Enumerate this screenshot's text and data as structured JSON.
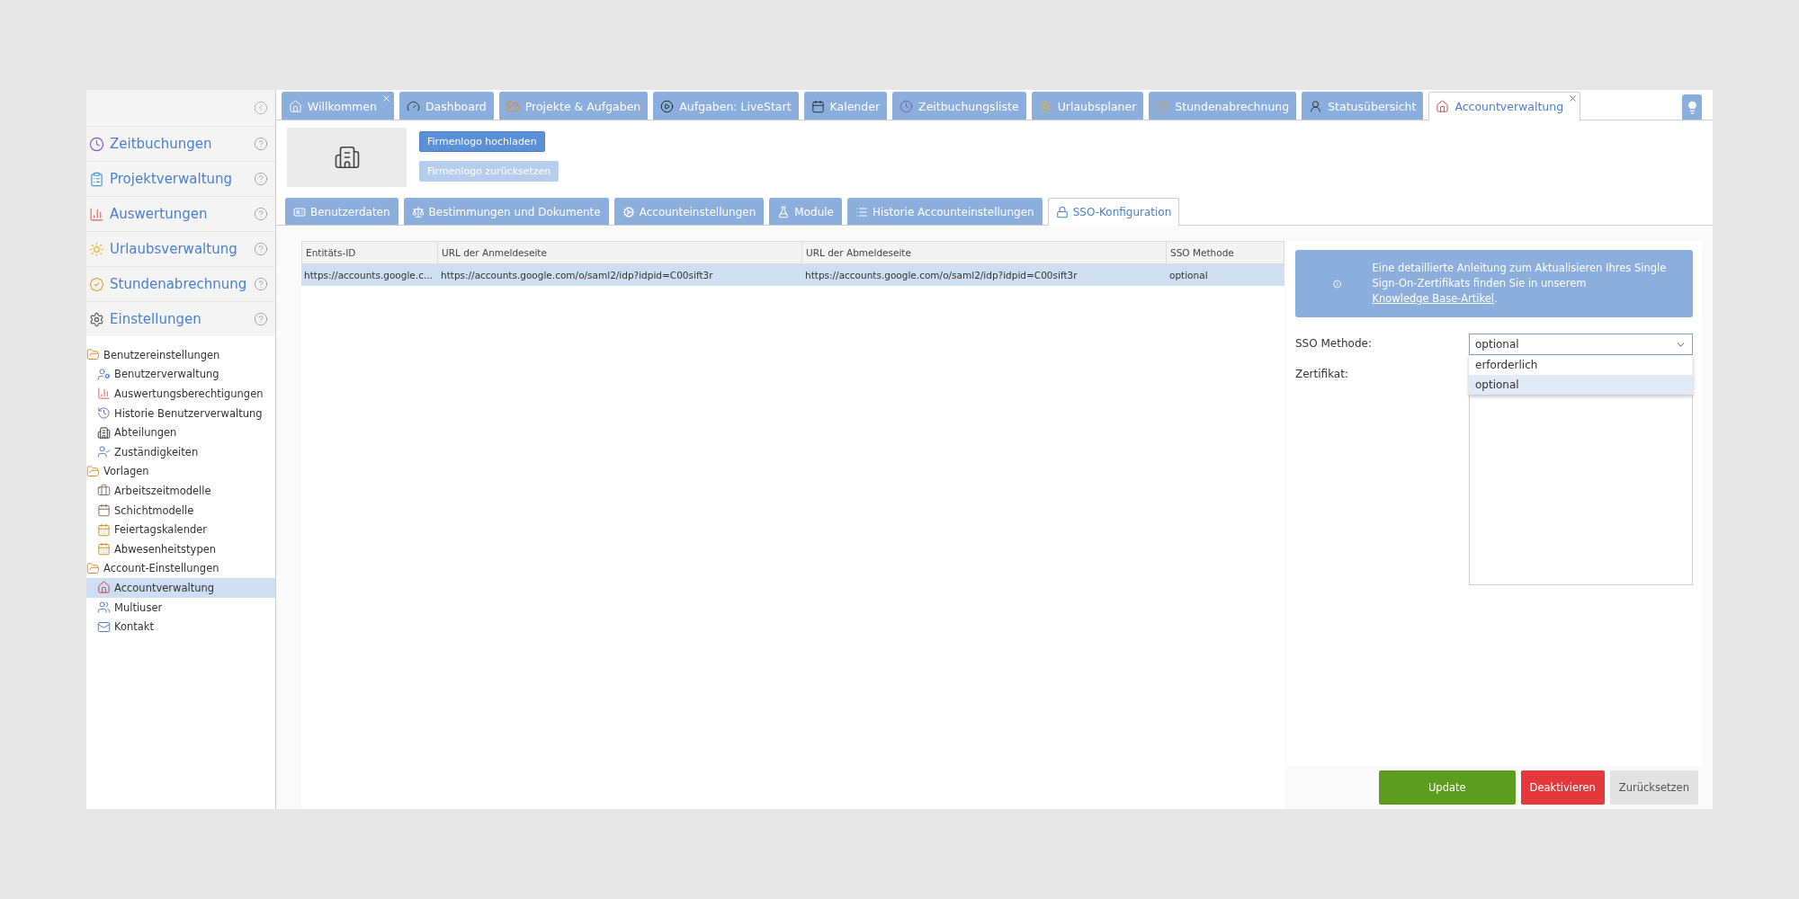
{
  "sidebar": {
    "sections": [
      {
        "label": "Zeitbuchungen"
      },
      {
        "label": "Projektverwaltung"
      },
      {
        "label": "Auswertungen"
      },
      {
        "label": "Urlaubsverwaltung"
      },
      {
        "label": "Stundenabrechnung"
      },
      {
        "label": "Einstellungen"
      }
    ],
    "tree": [
      {
        "label": "Benutzereinstellungen",
        "selected": false,
        "children": [
          {
            "label": "Benutzerverwaltung",
            "selected": false
          },
          {
            "label": "Auswertungsberechtigungen",
            "selected": false
          },
          {
            "label": "Historie Benutzerverwaltung",
            "selected": false
          },
          {
            "label": "Abteilungen",
            "selected": false
          },
          {
            "label": "Zuständigkeiten",
            "selected": false
          }
        ]
      },
      {
        "label": "Vorlagen",
        "selected": false,
        "children": [
          {
            "label": "Arbeitszeitmodelle",
            "selected": false
          },
          {
            "label": "Schichtmodelle",
            "selected": false
          },
          {
            "label": "Feiertagskalender",
            "selected": false
          },
          {
            "label": "Abwesenheitstypen",
            "selected": false
          }
        ]
      },
      {
        "label": "Account-Einstellungen",
        "selected": false,
        "children": [
          {
            "label": "Accountverwaltung",
            "selected": true
          },
          {
            "label": "Multiuser",
            "selected": false
          },
          {
            "label": "Kontakt",
            "selected": false
          }
        ]
      }
    ]
  },
  "tabs": [
    {
      "label": "Willkommen",
      "selected": false,
      "closable": true
    },
    {
      "label": "Dashboard",
      "selected": false,
      "closable": false
    },
    {
      "label": "Projekte & Aufgaben",
      "selected": false,
      "closable": false
    },
    {
      "label": "Aufgaben: LiveStart",
      "selected": false,
      "closable": false
    },
    {
      "label": "Kalender",
      "selected": false,
      "closable": false
    },
    {
      "label": "Zeitbuchungsliste",
      "selected": false,
      "closable": false
    },
    {
      "label": "Urlaubsplaner",
      "selected": false,
      "closable": false
    },
    {
      "label": "Stundenabrechnung",
      "selected": false,
      "closable": false
    },
    {
      "label": "Statusübersicht",
      "selected": false,
      "closable": false
    },
    {
      "label": "Accountverwaltung",
      "selected": true,
      "closable": true
    }
  ],
  "logo": {
    "buttons": [
      {
        "label": "Firmenlogo hochladen",
        "disabled": false
      },
      {
        "label": "Firmenlogo zurücksetzen",
        "disabled": true
      }
    ]
  },
  "subtabs": [
    {
      "label": "Benutzerdaten",
      "selected": false
    },
    {
      "label": "Bestimmungen und Dokumente",
      "selected": false
    },
    {
      "label": "Accounteinstellungen",
      "selected": false
    },
    {
      "label": "Module",
      "selected": false
    },
    {
      "label": "Historie Accounteinstellungen",
      "selected": false
    },
    {
      "label": "SSO-Konfiguration",
      "selected": true
    }
  ],
  "table": {
    "columns": [
      "Entitäts-ID",
      "URL der Anmeldeseite",
      "URL der Abmeldeseite",
      "SSO Methode"
    ],
    "rows": [
      {
        "selected": true,
        "cells": [
          "https://accounts.google.c...",
          "https://accounts.google.com/o/saml2/idp?idpid=C00sift3r",
          "https://accounts.google.com/o/saml2/idp?idpid=C00sift3r",
          "optional"
        ]
      }
    ]
  },
  "info": {
    "text": "Eine detaillierte Anleitung zum Aktualisieren Ihres Single Sign-On-Zertifikats finden Sie in unserem ",
    "link": "Knowledge Base-Artikel",
    "suffix": "."
  },
  "form": {
    "sso_label": "SSO Methode:",
    "sso_value": "optional",
    "expanded": true,
    "options": [
      {
        "label": "erforderlich",
        "selected": false
      },
      {
        "label": "optional",
        "selected": true
      }
    ],
    "cert_label": "Zertifikat:"
  },
  "actions": [
    {
      "label": "Update",
      "kind": "primary"
    },
    {
      "label": "Deaktivieren",
      "kind": "danger"
    },
    {
      "label": "Zurücksetzen",
      "kind": "secondary"
    }
  ]
}
